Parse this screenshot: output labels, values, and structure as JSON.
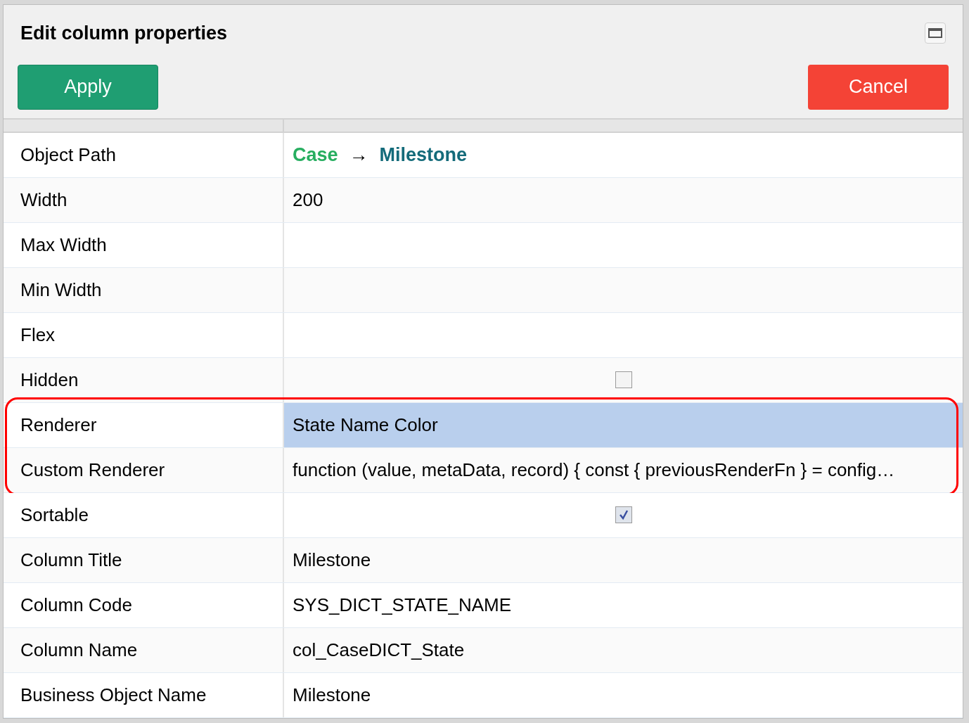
{
  "dialog": {
    "title": "Edit column properties",
    "buttons": [
      {
        "label": "Apply",
        "kind": "primary"
      },
      {
        "label": "Cancel",
        "kind": "danger"
      }
    ]
  },
  "properties": [
    {
      "label": "Object Path",
      "kind": "path",
      "path": [
        {
          "text": "Case",
          "color": "#27ae60"
        },
        {
          "text": "→",
          "color": "#000000"
        },
        {
          "text": "Milestone",
          "color": "#146b7a"
        }
      ],
      "selected": false,
      "outlined": false
    },
    {
      "label": "Width",
      "kind": "text",
      "value": "200",
      "selected": false,
      "outlined": false
    },
    {
      "label": "Max Width",
      "kind": "text",
      "selected": false,
      "outlined": false
    },
    {
      "label": "Min Width",
      "kind": "text",
      "selected": false,
      "outlined": false
    },
    {
      "label": "Flex",
      "kind": "text",
      "selected": false,
      "outlined": false
    },
    {
      "label": "Hidden",
      "kind": "checkbox",
      "checked": false,
      "selected": false,
      "outlined": false
    },
    {
      "label": "Renderer",
      "kind": "text",
      "value": "State Name Color",
      "selected": true,
      "outlined": true
    },
    {
      "label": "Custom Renderer",
      "kind": "text",
      "value": "function (value, metaData, record) { const { previousRenderFn } = config…",
      "selected": false,
      "outlined": true
    },
    {
      "label": "Sortable",
      "kind": "checkbox",
      "checked": true,
      "selected": false,
      "outlined": false
    },
    {
      "label": "Column Title",
      "kind": "text",
      "value": "Milestone",
      "selected": false,
      "outlined": false
    },
    {
      "label": "Column Code",
      "kind": "text",
      "value": "SYS_DICT_STATE_NAME",
      "selected": false,
      "outlined": false
    },
    {
      "label": "Column Name",
      "kind": "text",
      "value": "col_CaseDICT_State",
      "selected": false,
      "outlined": false
    },
    {
      "label": "Business Object Name",
      "kind": "text",
      "value": "Milestone",
      "selected": false,
      "outlined": false
    }
  ]
}
